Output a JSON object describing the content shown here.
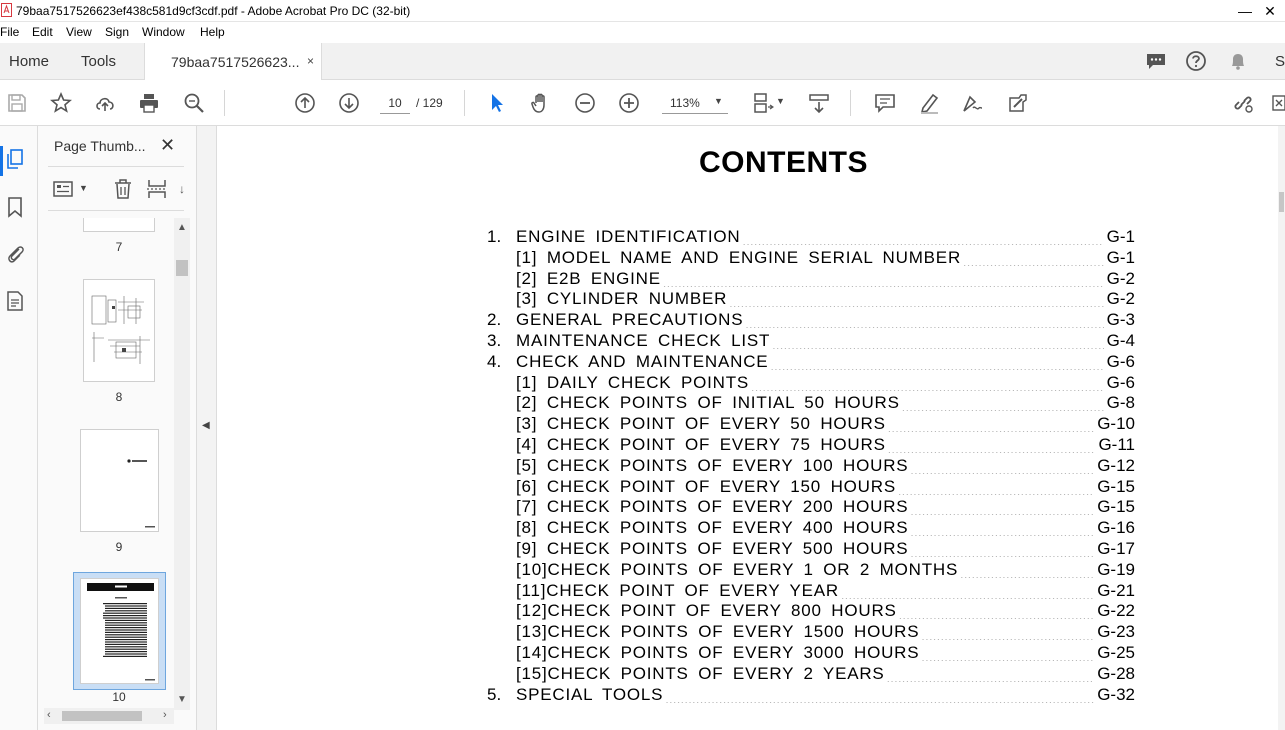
{
  "window": {
    "title": "79baa7517526623ef438c581d9cf3cdf.pdf - Adobe Acrobat Pro DC (32-bit)",
    "close": "✕"
  },
  "menu": [
    "File",
    "Edit",
    "View",
    "Sign",
    "Window",
    "Help"
  ],
  "tabs": {
    "home": "Home",
    "tools": "Tools",
    "document": "79baa7517526623...",
    "close": "×",
    "right_letter": "S"
  },
  "toolbar": {
    "current_page": "10",
    "total_pages": "/  129",
    "zoom": "113%"
  },
  "thumbnail_panel": {
    "title": "Page Thumb...",
    "close": "✕",
    "thumbnails": [
      {
        "label": "7"
      },
      {
        "label": "8"
      },
      {
        "label": "9"
      },
      {
        "label": "10",
        "selected": true
      }
    ]
  },
  "document": {
    "title": "CONTENTS",
    "toc": [
      {
        "num": "1.",
        "text": "ENGINE IDENTIFICATION",
        "page": "G-1",
        "level": 1
      },
      {
        "num": "",
        "text": "[1] MODEL NAME AND ENGINE SERIAL NUMBER",
        "page": "G-1",
        "level": 2
      },
      {
        "num": "",
        "text": "[2] E2B ENGINE",
        "page": "G-2",
        "level": 2
      },
      {
        "num": "",
        "text": "[3] CYLINDER NUMBER",
        "page": "G-2",
        "level": 2
      },
      {
        "num": "2.",
        "text": "GENERAL PRECAUTIONS",
        "page": "G-3",
        "level": 1
      },
      {
        "num": "3.",
        "text": "MAINTENANCE CHECK LIST",
        "page": "G-4",
        "level": 1
      },
      {
        "num": "4.",
        "text": "CHECK AND MAINTENANCE",
        "page": "G-6",
        "level": 1
      },
      {
        "num": "",
        "text": "[1] DAILY CHECK POINTS",
        "page": "G-6",
        "level": 2
      },
      {
        "num": "",
        "text": "[2] CHECK POINTS OF INITIAL 50 HOURS",
        "page": "G-8",
        "level": 2
      },
      {
        "num": "",
        "text": "[3] CHECK POINT OF EVERY 50 HOURS",
        "page": "G-10",
        "level": 2
      },
      {
        "num": "",
        "text": "[4] CHECK POINT OF EVERY 75 HOURS",
        "page": "G-11",
        "level": 2
      },
      {
        "num": "",
        "text": "[5] CHECK POINTS OF EVERY 100 HOURS",
        "page": "G-12",
        "level": 2
      },
      {
        "num": "",
        "text": "[6] CHECK POINT OF EVERY 150 HOURS",
        "page": "G-15",
        "level": 2
      },
      {
        "num": "",
        "text": "[7] CHECK POINTS OF EVERY 200 HOURS",
        "page": "G-15",
        "level": 2
      },
      {
        "num": "",
        "text": "[8] CHECK POINTS OF EVERY 400 HOURS",
        "page": "G-16",
        "level": 2
      },
      {
        "num": "",
        "text": "[9] CHECK POINTS OF EVERY 500 HOURS",
        "page": "G-17",
        "level": 2
      },
      {
        "num": "",
        "text": "[10]CHECK POINTS OF EVERY 1 OR 2 MONTHS",
        "page": "G-19",
        "level": 2
      },
      {
        "num": "",
        "text": "[11]CHECK POINT OF EVERY YEAR",
        "page": "G-21",
        "level": 2
      },
      {
        "num": "",
        "text": "[12]CHECK POINT OF EVERY 800 HOURS",
        "page": "G-22",
        "level": 2
      },
      {
        "num": "",
        "text": "[13]CHECK POINTS OF EVERY 1500 HOURS",
        "page": "G-23",
        "level": 2
      },
      {
        "num": "",
        "text": "[14]CHECK POINTS OF EVERY 3000 HOURS",
        "page": "G-25",
        "level": 2
      },
      {
        "num": "",
        "text": "[15]CHECK POINTS OF EVERY 2 YEARS",
        "page": "G-28",
        "level": 2
      },
      {
        "num": "5.",
        "text": "SPECIAL TOOLS",
        "page": "G-32",
        "level": 1
      }
    ]
  },
  "icons": {
    "toolbar": [
      "save-icon",
      "star-icon",
      "cloud-upload-icon",
      "print-icon",
      "search-zoom-icon",
      "page-up-icon",
      "page-down-icon",
      "select-cursor-icon",
      "hand-icon",
      "zoom-out-icon",
      "zoom-in-icon",
      "fit-page-icon",
      "scroll-mode-icon",
      "comment-icon",
      "highlight-icon",
      "sign-icon",
      "edit-fill-icon",
      "share-link-icon"
    ],
    "accent": "#1473e6"
  }
}
